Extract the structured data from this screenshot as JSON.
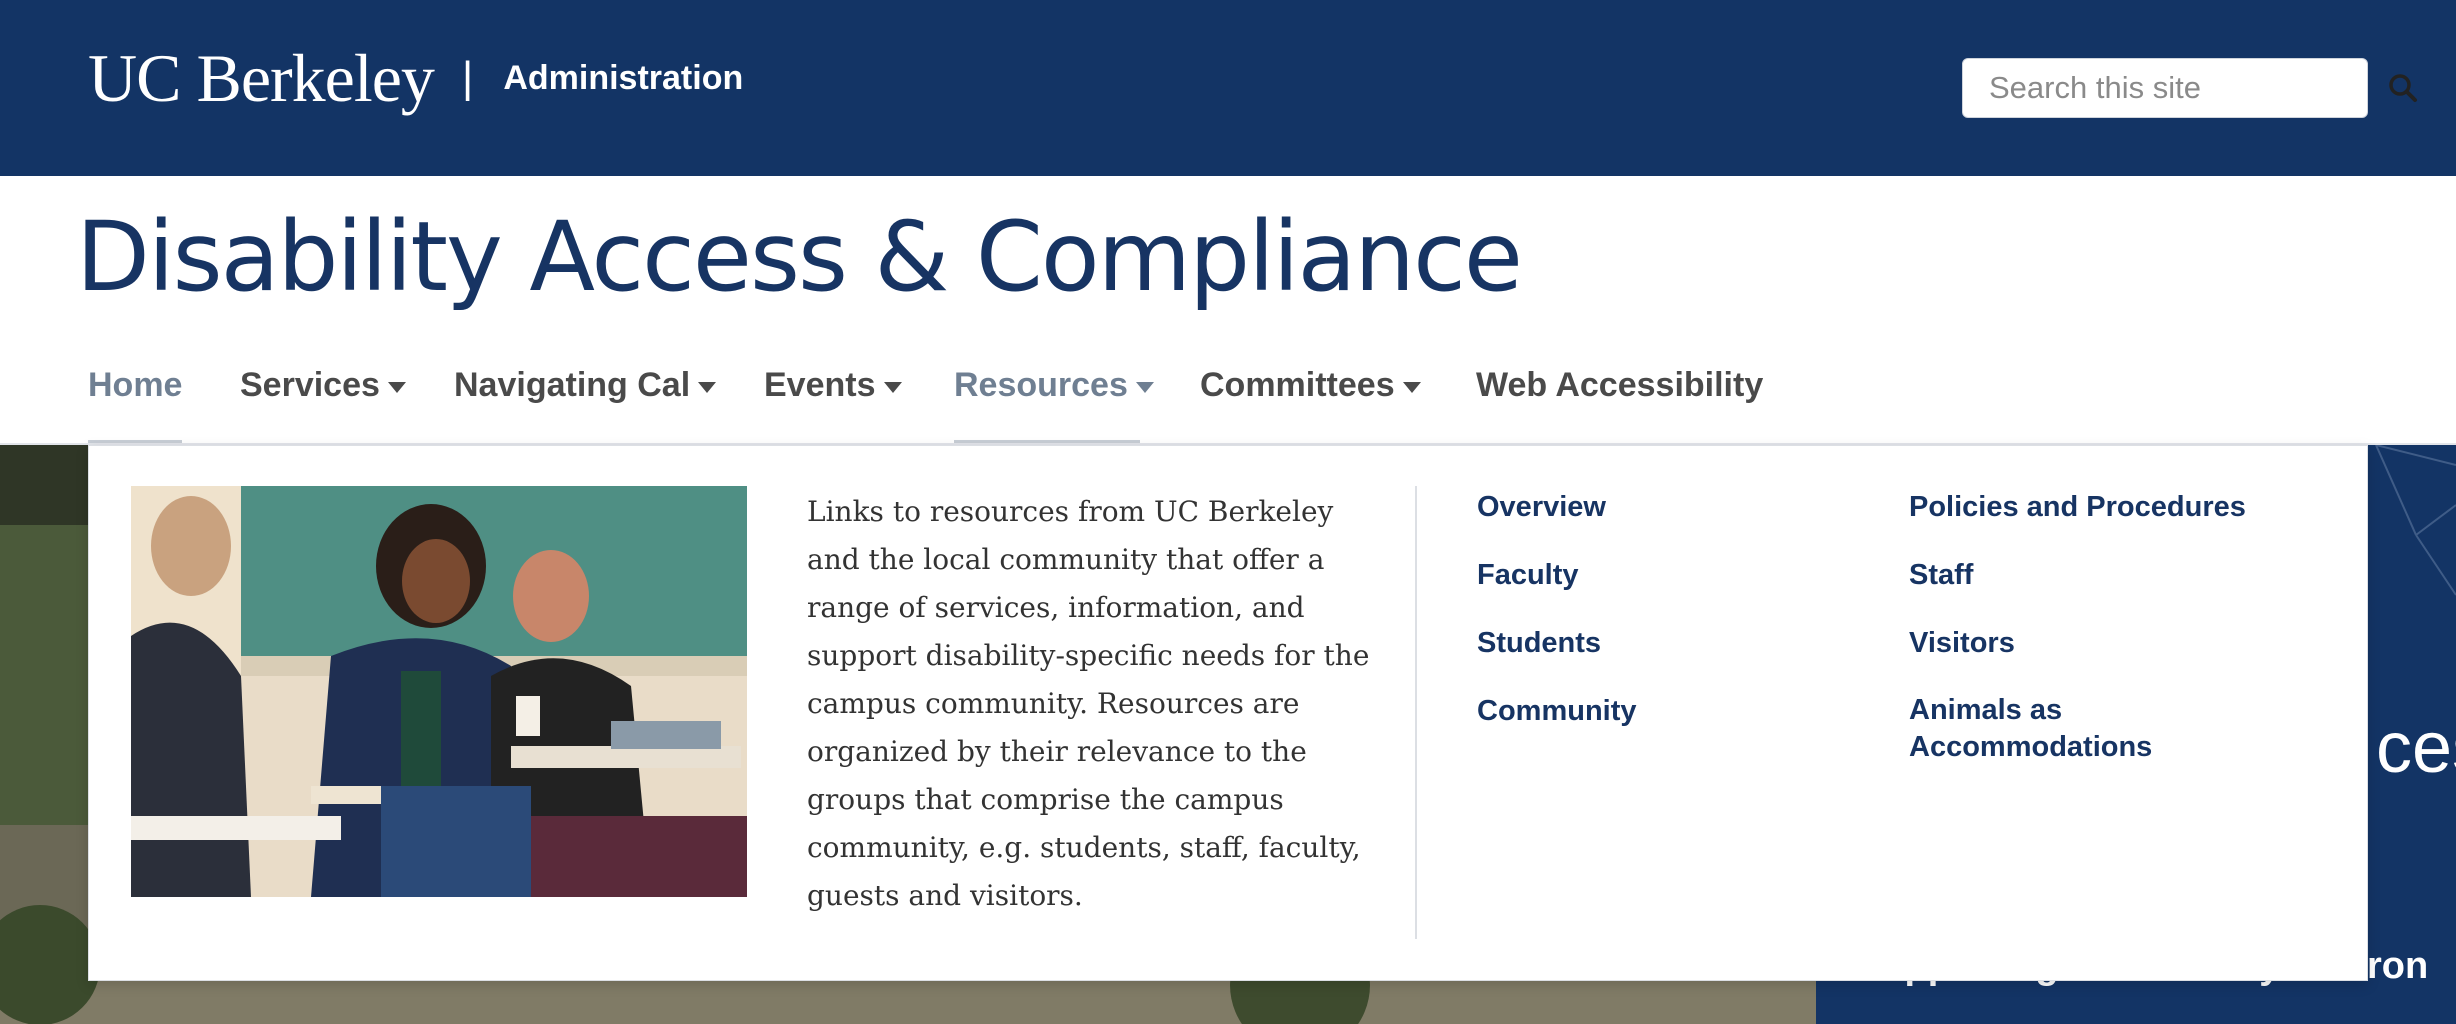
{
  "header": {
    "logo_text": "UC Berkeley",
    "separator": "|",
    "subtitle": "Administration",
    "search": {
      "placeholder": "Search this site",
      "icon": "search-icon"
    }
  },
  "site_title": "Disability Access & Compliance",
  "nav": {
    "items": [
      {
        "label": "Home",
        "active": true,
        "has_dropdown": false
      },
      {
        "label": "Services",
        "active": false,
        "has_dropdown": true
      },
      {
        "label": "Navigating Cal",
        "active": false,
        "has_dropdown": true
      },
      {
        "label": "Events",
        "active": false,
        "has_dropdown": true
      },
      {
        "label": "Resources",
        "active": true,
        "has_dropdown": true
      },
      {
        "label": "Committees",
        "active": false,
        "has_dropdown": true
      },
      {
        "label": "Web Accessibility",
        "active": false,
        "has_dropdown": false
      }
    ]
  },
  "dropdown": {
    "description": "Links to resources from UC Berkeley and the local community that offer a range of services, information, and support disability-specific needs for the campus community. Resources are organized by their relevance to the groups that comprise the campus community, e.g. students, staff, faculty, guests and visitors.",
    "links_col1": [
      "Overview",
      "Faculty",
      "Students",
      "Community"
    ],
    "links_col2": [
      "Policies and Procedures",
      "Staff",
      "Visitors",
      "Animals as Accommodations"
    ]
  },
  "hero": {
    "heading_fragment": "ces",
    "tagline_fragment": "Supporting a university environ"
  },
  "colors": {
    "brand_navy": "#133465",
    "title_navy": "#173463",
    "nav_gray": "#4a4a4a",
    "nav_active": "#6f7f92"
  }
}
